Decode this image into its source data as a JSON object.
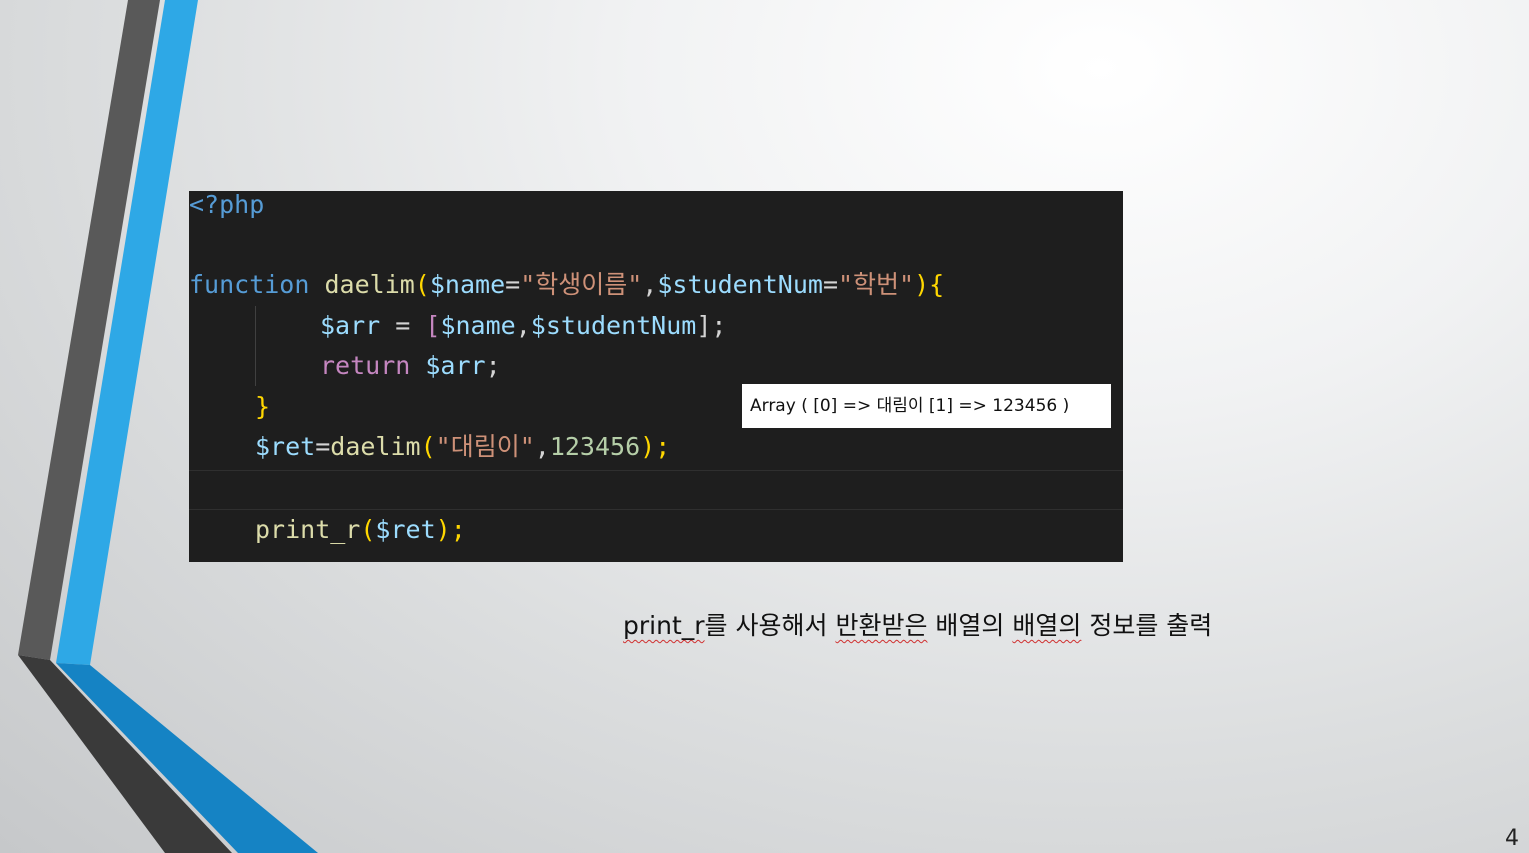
{
  "slide": {
    "page_number": "4",
    "accent_colors": {
      "blue": "#2ea8e6",
      "dark_blue": "#1583c4",
      "gray": "#595959",
      "dark_gray": "#3a3a3a"
    }
  },
  "code_editor": {
    "background": "#1e1e1e",
    "lines": {
      "open_tag": "<?php",
      "fn_keyword": "function",
      "fn_name": "daelim",
      "fn_paren_open": "(",
      "param1_var": "$name",
      "param1_eq": "=",
      "param1_default": "\"학생이름\"",
      "param_comma": ",",
      "param2_var": "$studentNum",
      "param2_eq": "=",
      "param2_default": "\"학번\"",
      "fn_paren_close": ")",
      "fn_brace_open": "{",
      "arr_var": "$arr",
      "arr_assign": " = ",
      "arr_bracket_open": "[",
      "arr_item1": "$name",
      "arr_comma": ",",
      "arr_item2": "$studentNum",
      "arr_bracket_close": "];",
      "return_keyword": "return",
      "return_var": " $arr",
      "return_semi": ";",
      "fn_brace_close": "}",
      "ret_var": "$ret",
      "ret_eq": "=",
      "ret_call": "daelim",
      "ret_paren_open": "(",
      "ret_arg1": "\"대림이\"",
      "ret_comma": ",",
      "ret_arg2": "123456",
      "ret_paren_close": ");",
      "print_fn": "print_r",
      "print_paren_open": "(",
      "print_var": "$ret",
      "print_paren_close": ");"
    }
  },
  "output": {
    "text": "Array ( [0] => 대림이 [1] => 123456 )"
  },
  "caption": {
    "part1": "print_r",
    "part2": "를 사용해서 ",
    "part3": "반환받은",
    "part4": " 배열의 ",
    "part5": "배열의",
    "part6": " 정보를 출력"
  }
}
